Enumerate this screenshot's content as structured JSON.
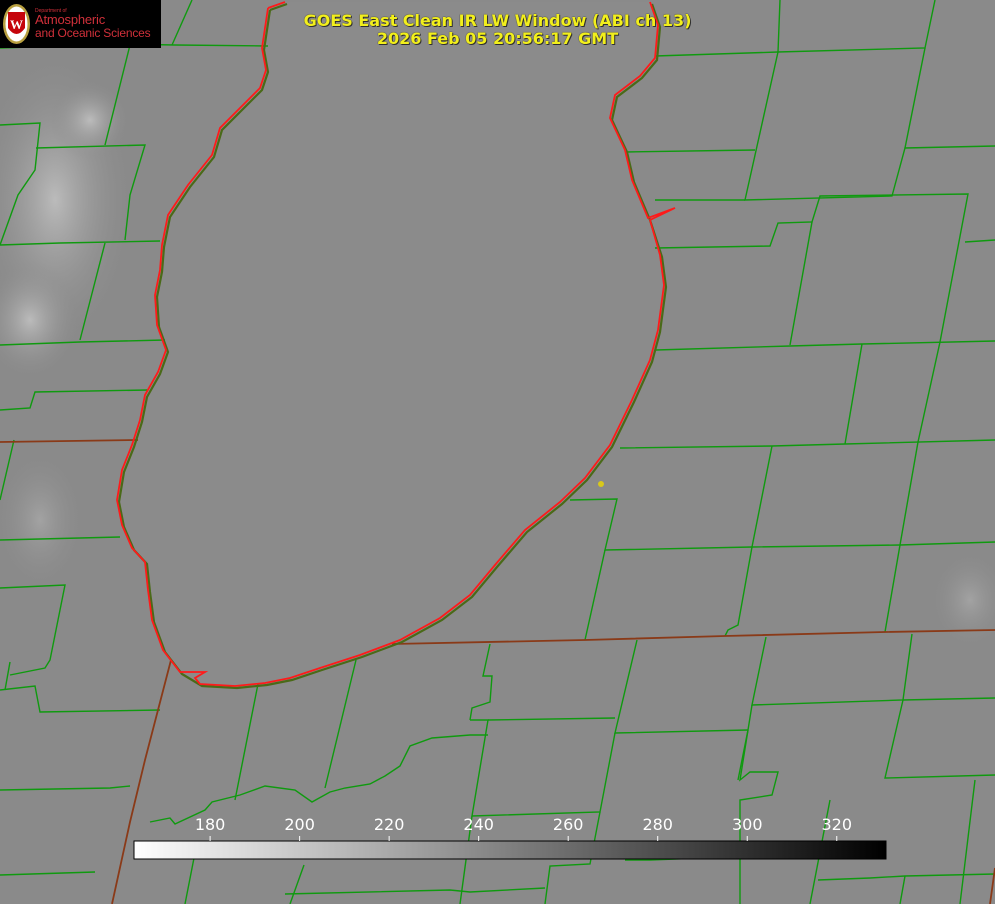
{
  "logo": {
    "dept": "Department of",
    "line1": "Atmospheric",
    "line2": "and Oceanic Sciences",
    "seal_letter": "W"
  },
  "title": {
    "line1": "GOES East Clean IR LW Window (ABI ch 13)",
    "line2": "2026 Feb 05 20:56:17 GMT"
  },
  "colorbar": {
    "min": 163,
    "max": 331,
    "ticks": [
      180,
      200,
      220,
      240,
      260,
      280,
      300,
      320
    ],
    "gradient": [
      "#ffffff",
      "#000000"
    ]
  },
  "colors": {
    "background": "#8a8a8a",
    "lake_fill": "#8b8b8b",
    "county_lines": "#0f9a0f",
    "state_lines": "#8a3a18",
    "shoreline": "#ff1a1a",
    "title_text": "#f2ef1c",
    "marker": "#d8c81a"
  },
  "map": {
    "marker_label": ""
  }
}
